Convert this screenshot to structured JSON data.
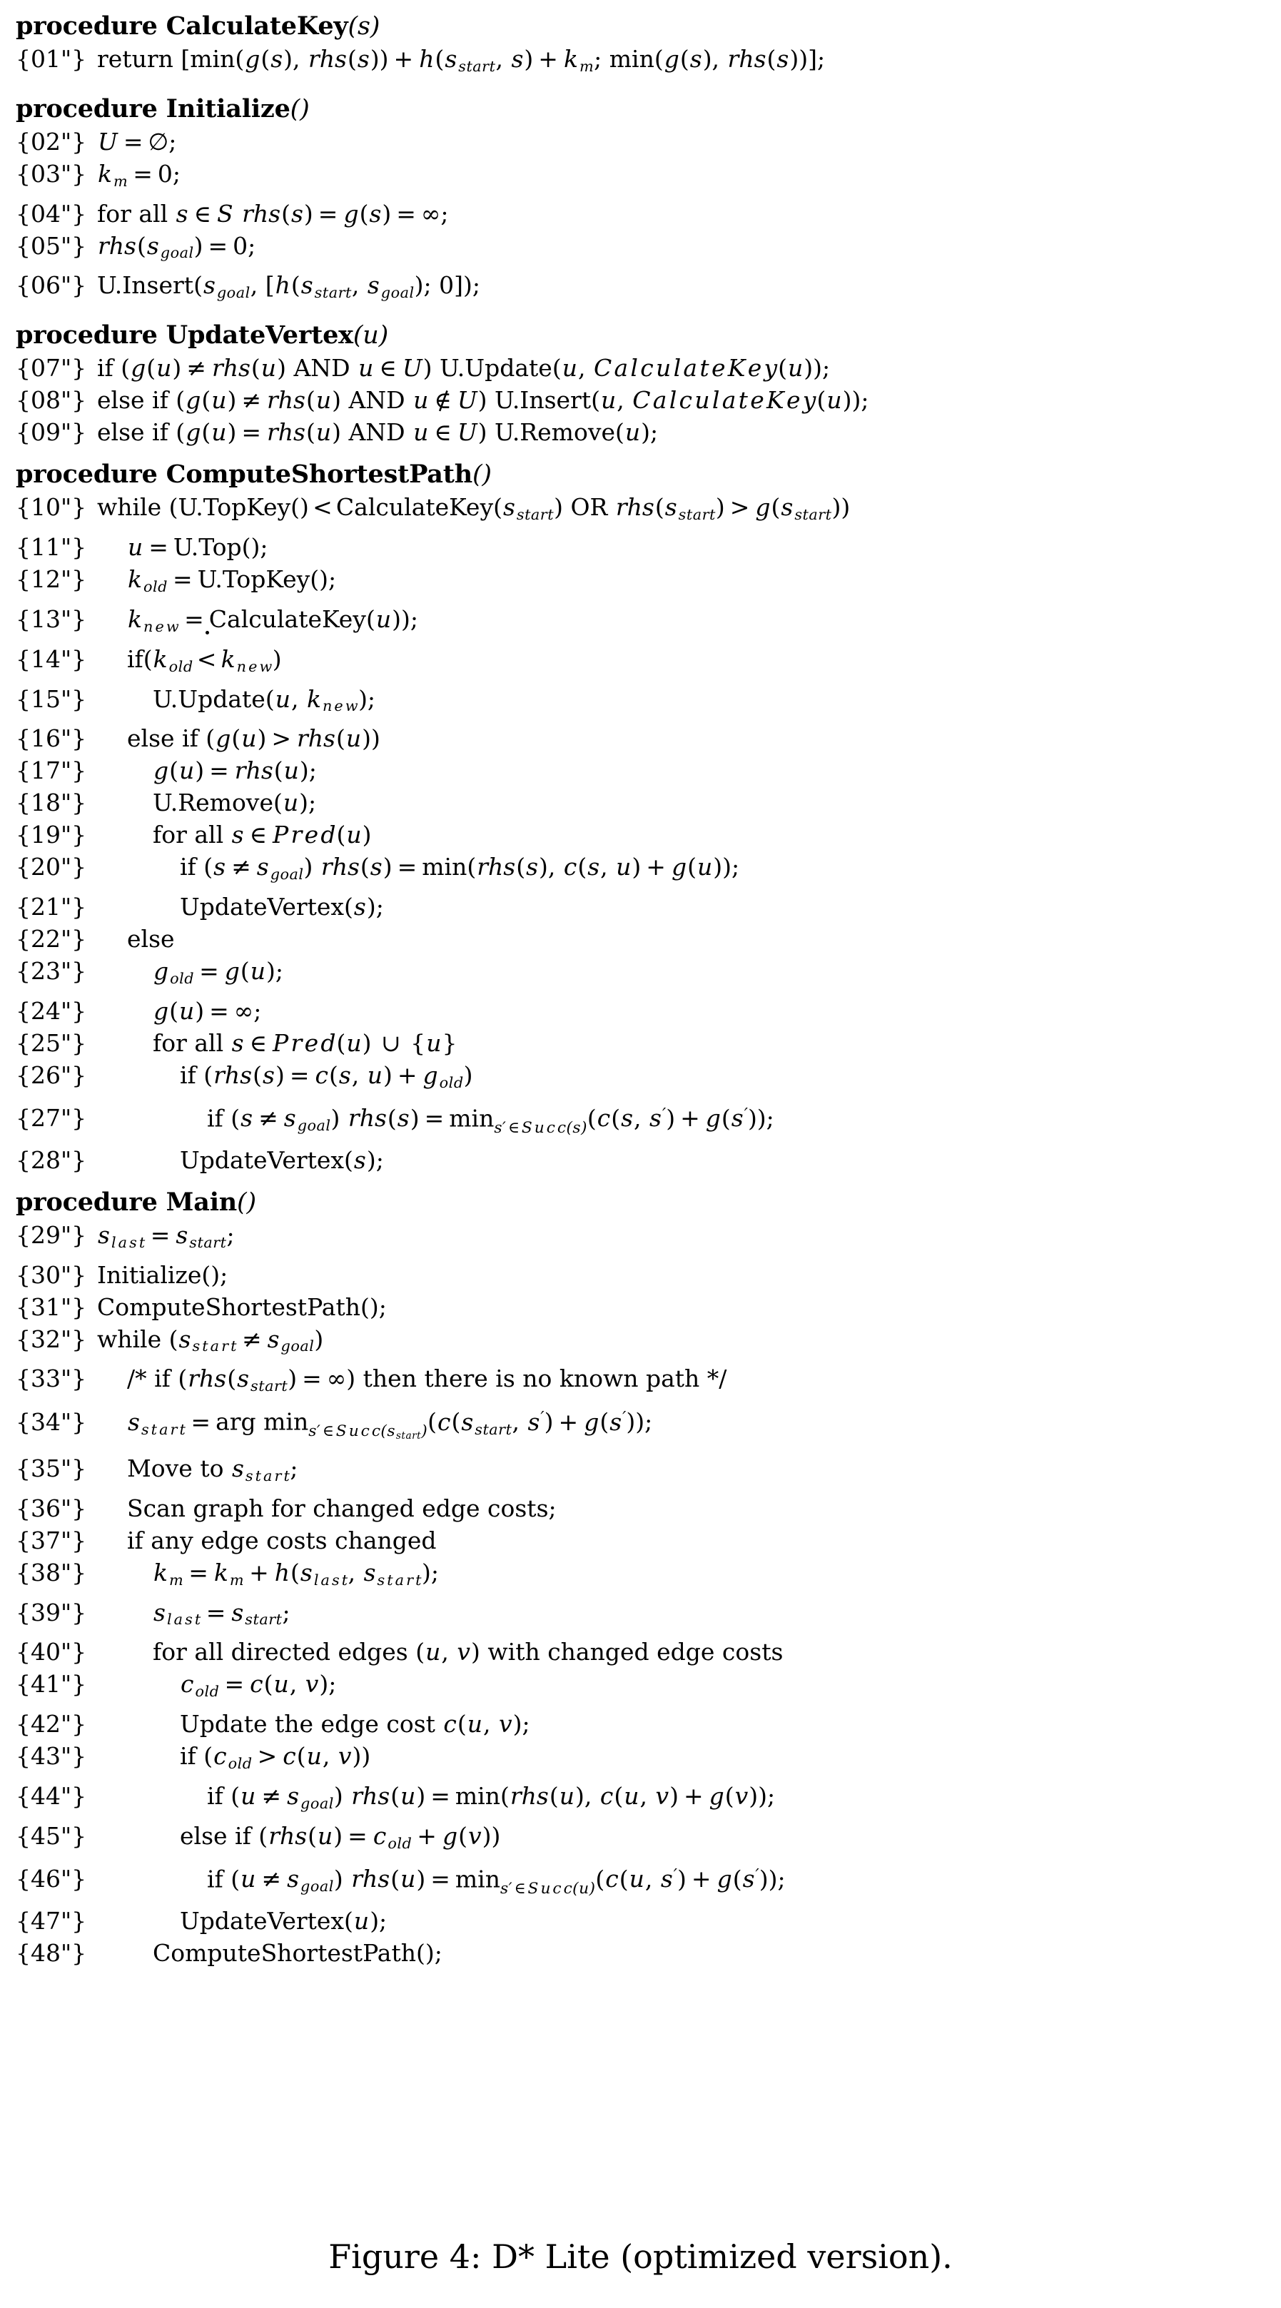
{
  "figure": {
    "caption": "Figure 4: D* Lite (optimized version).",
    "caption_label": "Figure 4:",
    "caption_text": "D* Lite (optimized version)."
  },
  "procedures": [
    {
      "keyword": "procedure",
      "name": "CalculateKey",
      "args": "(s)",
      "lines": [
        {
          "no": "{01\"}",
          "indent": 0,
          "text": "return [min(g(s), rhs(s)) + h(s_start, s) + k_m; min(g(s), rhs(s))];"
        }
      ]
    },
    {
      "keyword": "procedure",
      "name": "Initialize",
      "args": "()",
      "lines": [
        {
          "no": "{02\"}",
          "indent": 0,
          "text": "U = ∅;"
        },
        {
          "no": "{03\"}",
          "indent": 0,
          "text": "k_m = 0;"
        },
        {
          "no": "{04\"}",
          "indent": 0,
          "text": "for all s ∈ S rhs(s) = g(s) = ∞;"
        },
        {
          "no": "{05\"}",
          "indent": 0,
          "text": "rhs(s_goal) = 0;"
        },
        {
          "no": "{06\"}",
          "indent": 0,
          "text": "U.Insert(s_goal, [h(s_start, s_goal); 0]);"
        }
      ]
    },
    {
      "keyword": "procedure",
      "name": "UpdateVertex",
      "args": "(u)",
      "lines": [
        {
          "no": "{07\"}",
          "indent": 0,
          "text": "if (g(u) ≠ rhs(u) AND u ∈ U) U.Update(u, CalculateKey(u));"
        },
        {
          "no": "{08\"}",
          "indent": 0,
          "text": "else if (g(u) ≠ rhs(u) AND u ∉ U) U.Insert(u, CalculateKey(u));"
        },
        {
          "no": "{09\"}",
          "indent": 0,
          "text": "else if (g(u) = rhs(u) AND u ∈ U) U.Remove(u);"
        }
      ]
    },
    {
      "keyword": "procedure",
      "name": "ComputeShortestPath",
      "args": "()",
      "lines": [
        {
          "no": "{10\"}",
          "indent": 0,
          "text": "while (U.TopKey() <̇ CalculateKey(s_start) OR rhs(s_start) > g(s_start))"
        },
        {
          "no": "{11\"}",
          "indent": 1,
          "text": "u = U.Top();"
        },
        {
          "no": "{12\"}",
          "indent": 1,
          "text": "k_old = U.TopKey();"
        },
        {
          "no": "{13\"}",
          "indent": 1,
          "text": "k_new = CalculateKey(u));"
        },
        {
          "no": "{14\"}",
          "indent": 1,
          "text": "if(k_old <̇ k_new)"
        },
        {
          "no": "{15\"}",
          "indent": 2,
          "text": "U.Update(u, k_new);"
        },
        {
          "no": "{16\"}",
          "indent": 1,
          "text": "else if (g(u) > rhs(u))"
        },
        {
          "no": "{17\"}",
          "indent": 2,
          "text": "g(u) = rhs(u);"
        },
        {
          "no": "{18\"}",
          "indent": 2,
          "text": "U.Remove(u);"
        },
        {
          "no": "{19\"}",
          "indent": 2,
          "text": "for all s ∈ Pred(u)"
        },
        {
          "no": "{20\"}",
          "indent": 3,
          "text": "if (s ≠ s_goal) rhs(s) = min(rhs(s), c(s, u) + g(u));"
        },
        {
          "no": "{21\"}",
          "indent": 3,
          "text": "UpdateVertex(s);"
        },
        {
          "no": "{22\"}",
          "indent": 1,
          "text": "else"
        },
        {
          "no": "{23\"}",
          "indent": 2,
          "text": "g_old = g(u);"
        },
        {
          "no": "{24\"}",
          "indent": 2,
          "text": "g(u) = ∞;"
        },
        {
          "no": "{25\"}",
          "indent": 2,
          "text": "for all s ∈ Pred(u) ∪ {u}"
        },
        {
          "no": "{26\"}",
          "indent": 3,
          "text": "if (rhs(s) = c(s, u) + g_old)"
        },
        {
          "no": "{27\"}",
          "indent": 4,
          "text": "if (s ≠ s_goal) rhs(s) = min_{s' ∈ Succ(s)}(c(s, s') + g(s'));"
        },
        {
          "no": "{28\"}",
          "indent": 3,
          "text": "UpdateVertex(s);"
        }
      ]
    },
    {
      "keyword": "procedure",
      "name": "Main",
      "args": "()",
      "lines": [
        {
          "no": "{29\"}",
          "indent": 0,
          "text": "s_last = s_start;"
        },
        {
          "no": "{30\"}",
          "indent": 0,
          "text": "Initialize();"
        },
        {
          "no": "{31\"}",
          "indent": 0,
          "text": "ComputeShortestPath();"
        },
        {
          "no": "{32\"}",
          "indent": 0,
          "text": "while (s_start ≠ s_goal)"
        },
        {
          "no": "{33\"}",
          "indent": 1,
          "text": "/* if (rhs(s_start) = ∞) then there is no known path */"
        },
        {
          "no": "{34\"}",
          "indent": 1,
          "text": "s_start = arg min_{s' ∈ Succ(s_start)}(c(s_start, s') + g(s'));"
        },
        {
          "no": "{35\"}",
          "indent": 1,
          "text": "Move to s_start;"
        },
        {
          "no": "{36\"}",
          "indent": 1,
          "text": "Scan graph for changed edge costs;"
        },
        {
          "no": "{37\"}",
          "indent": 1,
          "text": "if any edge costs changed"
        },
        {
          "no": "{38\"}",
          "indent": 2,
          "text": "k_m = k_m + h(s_last, s_start);"
        },
        {
          "no": "{39\"}",
          "indent": 2,
          "text": "s_last = s_start;"
        },
        {
          "no": "{40\"}",
          "indent": 2,
          "text": "for all directed edges (u, v) with changed edge costs"
        },
        {
          "no": "{41\"}",
          "indent": 3,
          "text": "c_old = c(u, v);"
        },
        {
          "no": "{42\"}",
          "indent": 3,
          "text": "Update the edge cost c(u, v);"
        },
        {
          "no": "{43\"}",
          "indent": 3,
          "text": "if (c_old > c(u, v))"
        },
        {
          "no": "{44\"}",
          "indent": 4,
          "text": "if (u ≠ s_goal) rhs(u) = min(rhs(u), c(u, v) + g(v));"
        },
        {
          "no": "{45\"}",
          "indent": 3,
          "text": "else if (rhs(u) = c_old + g(v))"
        },
        {
          "no": "{46\"}",
          "indent": 4,
          "text": "if (u ≠ s_goal) rhs(u) = min_{s' ∈ Succ(u)}(c(u, s') + g(s'));"
        },
        {
          "no": "{47\"}",
          "indent": 3,
          "text": "UpdateVertex(u);"
        },
        {
          "no": "{48\"}",
          "indent": 2,
          "text": "ComputeShortestPath();"
        }
      ]
    }
  ]
}
